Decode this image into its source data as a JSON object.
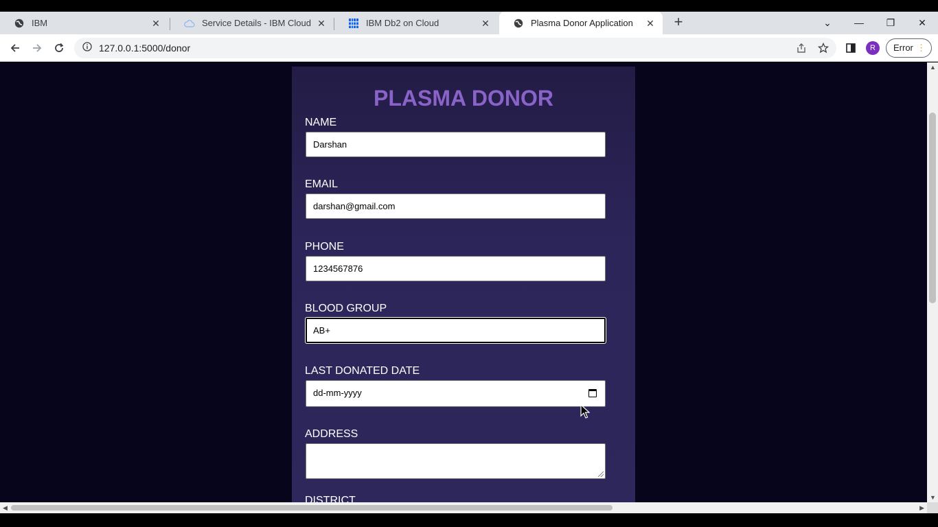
{
  "browser": {
    "tabs": [
      {
        "title": "IBM",
        "icon": "globe-icon",
        "active": false
      },
      {
        "title": "Service Details - IBM Cloud",
        "icon": "cloud-icon",
        "active": false
      },
      {
        "title": "IBM Db2 on Cloud",
        "icon": "db2-grid-icon",
        "active": false
      },
      {
        "title": "Plasma Donor Application",
        "icon": "globe-icon",
        "active": true
      }
    ],
    "url": "127.0.0.1:5000/donor",
    "profile_initial": "R",
    "error_label": "Error"
  },
  "form": {
    "title": "PLASMA DONOR",
    "fields": {
      "name": {
        "label": "NAME",
        "value": "Darshan"
      },
      "email": {
        "label": "EMAIL",
        "value": "darshan@gmail.com"
      },
      "phone": {
        "label": "PHONE",
        "value": "1234567876"
      },
      "blood_group": {
        "label": "BLOOD GROUP",
        "value": "AB+"
      },
      "last_donated_date": {
        "label": "LAST DONATED DATE",
        "placeholder": "dd-mm-yyyy"
      },
      "address": {
        "label": "ADDRESS",
        "value": ""
      },
      "district": {
        "label": "DISTRICT"
      }
    }
  },
  "colors": {
    "page_background": "#07051b",
    "card_background": "#2c2559",
    "title_color": "#8a63c8",
    "profile_color": "#7b2fbe"
  }
}
